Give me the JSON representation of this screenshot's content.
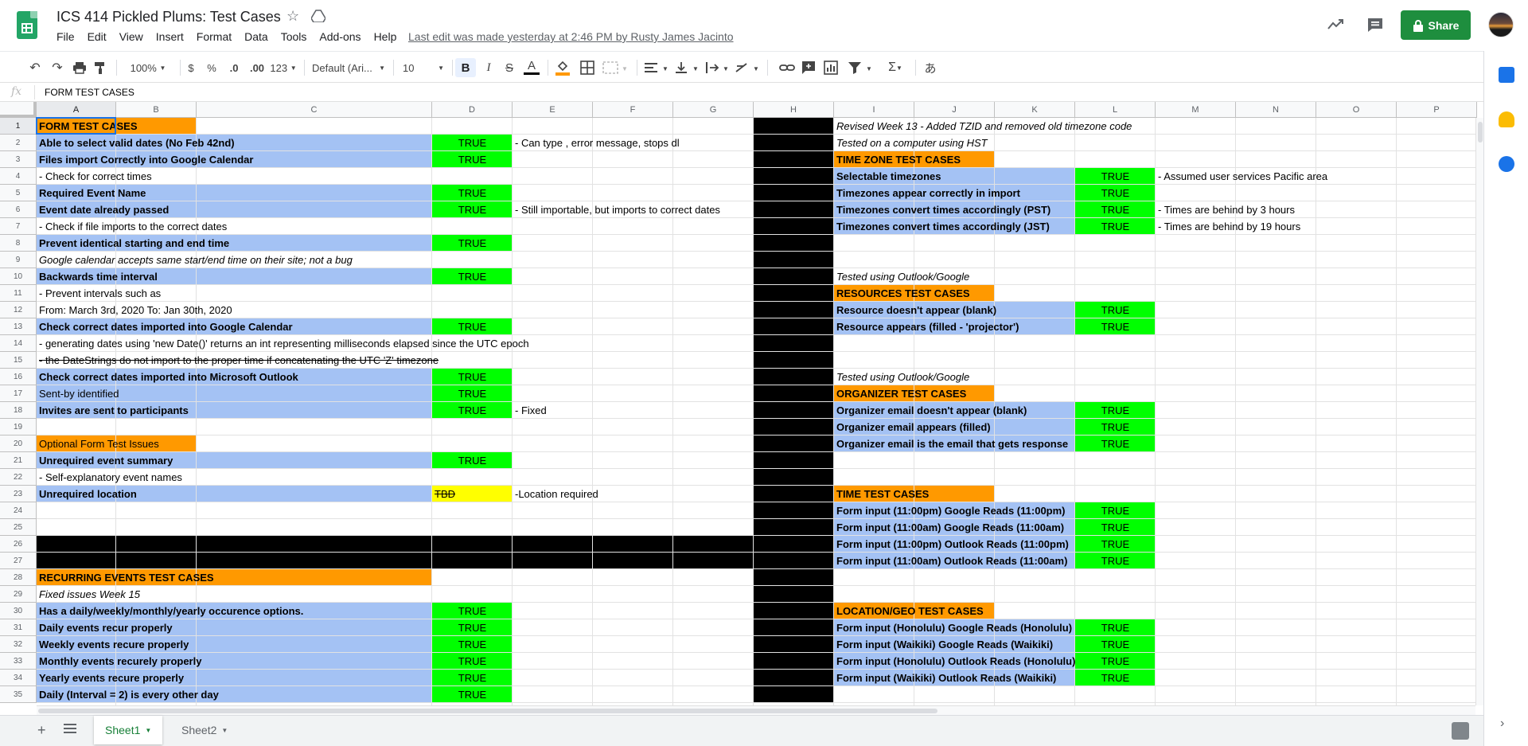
{
  "app": {
    "title": "ICS 414 Pickled Plums: Test Cases",
    "last_edit": "Last edit was made yesterday at 2:46 PM by Rusty James Jacinto",
    "share_label": "Share"
  },
  "menu": [
    "File",
    "Edit",
    "View",
    "Insert",
    "Format",
    "Data",
    "Tools",
    "Add-ons",
    "Help"
  ],
  "toolbar": {
    "zoom": "100%",
    "currency": "$",
    "percent": "%",
    "dec_less": ".0",
    "dec_more": ".00",
    "more_formats": "123",
    "font": "Default (Ari...",
    "font_size": "10",
    "input_tool": "あ"
  },
  "formula_bar": {
    "fx": "fx",
    "value": "FORM TEST CASES"
  },
  "columns": [
    "A",
    "B",
    "C",
    "D",
    "E",
    "F",
    "G",
    "H",
    "I",
    "J",
    "K",
    "L",
    "M",
    "N",
    "O",
    "P"
  ],
  "selected_column": "A",
  "rows": [
    "1",
    "2",
    "3",
    "4",
    "5",
    "6",
    "7",
    "8",
    "9",
    "10",
    "11",
    "12",
    "13",
    "14",
    "15",
    "16",
    "17",
    "18",
    "19",
    "20",
    "21",
    "22",
    "23",
    "24",
    "25",
    "26",
    "27",
    "28",
    "29",
    "30",
    "31",
    "32",
    "33",
    "34",
    "35"
  ],
  "selected_row": "1",
  "cells": [
    {
      "col": "A",
      "row": 1,
      "text": "FORM TEST CASES",
      "style": "b"
    },
    {
      "col": "A",
      "row": 2,
      "text": "Able to select valid dates (No Feb 42nd)",
      "style": "b"
    },
    {
      "col": "D",
      "row": 2,
      "text": "TRUE",
      "style": "c"
    },
    {
      "col": "E",
      "row": 2,
      "text": "- Can type , error message, stops dl",
      "style": ""
    },
    {
      "col": "A",
      "row": 3,
      "text": "Files import Correctly into Google Calendar",
      "style": "b"
    },
    {
      "col": "D",
      "row": 3,
      "text": "TRUE",
      "style": "c"
    },
    {
      "col": "A",
      "row": 4,
      "text": "- Check for correct times",
      "style": ""
    },
    {
      "col": "A",
      "row": 5,
      "text": "Required Event Name",
      "style": "b"
    },
    {
      "col": "D",
      "row": 5,
      "text": "TRUE",
      "style": "c"
    },
    {
      "col": "A",
      "row": 6,
      "text": "Event date already passed",
      "style": "b"
    },
    {
      "col": "D",
      "row": 6,
      "text": "TRUE",
      "style": "c"
    },
    {
      "col": "E",
      "row": 6,
      "text": "- Still importable, but imports to correct dates",
      "style": ""
    },
    {
      "col": "A",
      "row": 7,
      "text": "- Check if file imports to the correct dates",
      "style": ""
    },
    {
      "col": "A",
      "row": 8,
      "text": "Prevent identical starting and end time",
      "style": "b"
    },
    {
      "col": "D",
      "row": 8,
      "text": "TRUE",
      "style": "c"
    },
    {
      "col": "A",
      "row": 9,
      "text": "Google calendar accepts same start/end time on their site; not a bug",
      "style": "i"
    },
    {
      "col": "A",
      "row": 10,
      "text": "Backwards time interval",
      "style": "b"
    },
    {
      "col": "D",
      "row": 10,
      "text": "TRUE",
      "style": "c"
    },
    {
      "col": "A",
      "row": 11,
      "text": "- Prevent intervals such as",
      "style": ""
    },
    {
      "col": "A",
      "row": 12,
      "text": "  From: March 3rd, 2020 To: Jan 30th, 2020",
      "style": ""
    },
    {
      "col": "A",
      "row": 13,
      "text": "Check correct dates imported into Google Calendar",
      "style": "b"
    },
    {
      "col": "D",
      "row": 13,
      "text": "TRUE",
      "style": "c"
    },
    {
      "col": "A",
      "row": 14,
      "text": "- generating dates using 'new Date()' returns an int representing milliseconds elapsed since the UTC epoch",
      "style": ""
    },
    {
      "col": "A",
      "row": 15,
      "text": "- the DateStrings do not import to the proper time if concatenating the UTC 'Z' timezone",
      "style": "s"
    },
    {
      "col": "A",
      "row": 16,
      "text": "Check correct dates imported into Microsoft Outlook",
      "style": "b"
    },
    {
      "col": "D",
      "row": 16,
      "text": "TRUE",
      "style": "c"
    },
    {
      "col": "A",
      "row": 17,
      "text": "Sent-by identified",
      "style": ""
    },
    {
      "col": "D",
      "row": 17,
      "text": "TRUE",
      "style": "c"
    },
    {
      "col": "A",
      "row": 18,
      "text": "Invites are sent to participants",
      "style": "b"
    },
    {
      "col": "D",
      "row": 18,
      "text": "TRUE",
      "style": "c"
    },
    {
      "col": "E",
      "row": 18,
      "text": "- Fixed",
      "style": ""
    },
    {
      "col": "A",
      "row": 20,
      "text": "Optional Form Test Issues",
      "style": ""
    },
    {
      "col": "A",
      "row": 21,
      "text": "Unrequired event summary",
      "style": "b"
    },
    {
      "col": "D",
      "row": 21,
      "text": "TRUE",
      "style": "c"
    },
    {
      "col": "A",
      "row": 22,
      "text": "- Self-explanatory event names",
      "style": ""
    },
    {
      "col": "A",
      "row": 23,
      "text": "Unrequired location",
      "style": "b"
    },
    {
      "col": "D",
      "row": 23,
      "text": "TBD",
      "style": "s"
    },
    {
      "col": "E",
      "row": 23,
      "text": "-Location required",
      "style": ""
    },
    {
      "col": "A",
      "row": 28,
      "text": "RECURRING EVENTS TEST CASES",
      "style": "b"
    },
    {
      "col": "A",
      "row": 29,
      "text": "Fixed issues Week 15",
      "style": "i"
    },
    {
      "col": "A",
      "row": 30,
      "text": "Has a daily/weekly/monthly/yearly occurence options.",
      "style": "b"
    },
    {
      "col": "D",
      "row": 30,
      "text": "TRUE",
      "style": "c"
    },
    {
      "col": "A",
      "row": 31,
      "text": "Daily events recur properly",
      "style": "b"
    },
    {
      "col": "D",
      "row": 31,
      "text": "TRUE",
      "style": "c"
    },
    {
      "col": "A",
      "row": 32,
      "text": "Weekly events recure properly",
      "style": "b"
    },
    {
      "col": "D",
      "row": 32,
      "text": "TRUE",
      "style": "c"
    },
    {
      "col": "A",
      "row": 33,
      "text": "Monthly events recurely properly",
      "style": "b"
    },
    {
      "col": "D",
      "row": 33,
      "text": "TRUE",
      "style": "c"
    },
    {
      "col": "A",
      "row": 34,
      "text": "Yearly events recure properly",
      "style": "b"
    },
    {
      "col": "D",
      "row": 34,
      "text": "TRUE",
      "style": "c"
    },
    {
      "col": "A",
      "row": 35,
      "text": "Daily (Interval = 2) is every other day",
      "style": "b"
    },
    {
      "col": "D",
      "row": 35,
      "text": "TRUE",
      "style": "c"
    },
    {
      "col": "I",
      "row": 1,
      "text": "Revised Week 13 - Added TZID and removed old timezone code",
      "style": "i"
    },
    {
      "col": "I",
      "row": 2,
      "text": "Tested on a computer using HST",
      "style": "i"
    },
    {
      "col": "I",
      "row": 3,
      "text": "TIME ZONE TEST CASES",
      "style": "b"
    },
    {
      "col": "I",
      "row": 4,
      "text": "Selectable timezones",
      "style": "b"
    },
    {
      "col": "L",
      "row": 4,
      "text": "TRUE",
      "style": "c"
    },
    {
      "col": "M",
      "row": 4,
      "text": "- Assumed user services Pacific area",
      "style": ""
    },
    {
      "col": "I",
      "row": 5,
      "text": "Timezones appear correctly in import",
      "style": "b"
    },
    {
      "col": "L",
      "row": 5,
      "text": "TRUE",
      "style": "c"
    },
    {
      "col": "I",
      "row": 6,
      "text": "Timezones convert times accordingly (PST)",
      "style": "b"
    },
    {
      "col": "L",
      "row": 6,
      "text": "TRUE",
      "style": "c"
    },
    {
      "col": "M",
      "row": 6,
      "text": "- Times are behind by 3 hours",
      "style": ""
    },
    {
      "col": "I",
      "row": 7,
      "text": "Timezones convert times accordingly (JST)",
      "style": "b"
    },
    {
      "col": "L",
      "row": 7,
      "text": "TRUE",
      "style": "c"
    },
    {
      "col": "M",
      "row": 7,
      "text": "- Times are behind by 19 hours",
      "style": ""
    },
    {
      "col": "I",
      "row": 10,
      "text": "Tested using Outlook/Google",
      "style": "i"
    },
    {
      "col": "I",
      "row": 11,
      "text": "RESOURCES TEST CASES",
      "style": "b"
    },
    {
      "col": "I",
      "row": 12,
      "text": "Resource doesn't appear (blank)",
      "style": "b"
    },
    {
      "col": "L",
      "row": 12,
      "text": "TRUE",
      "style": "c"
    },
    {
      "col": "I",
      "row": 13,
      "text": "Resource appears (filled - 'projector')",
      "style": "b"
    },
    {
      "col": "L",
      "row": 13,
      "text": "TRUE",
      "style": "c"
    },
    {
      "col": "I",
      "row": 16,
      "text": "Tested using Outlook/Google",
      "style": "i"
    },
    {
      "col": "I",
      "row": 17,
      "text": "ORGANIZER TEST CASES",
      "style": "b"
    },
    {
      "col": "I",
      "row": 18,
      "text": "Organizer email doesn't appear (blank)",
      "style": "b"
    },
    {
      "col": "L",
      "row": 18,
      "text": "TRUE",
      "style": "c"
    },
    {
      "col": "I",
      "row": 19,
      "text": "Organizer email appears (filled)",
      "style": "b"
    },
    {
      "col": "L",
      "row": 19,
      "text": "TRUE",
      "style": "c"
    },
    {
      "col": "I",
      "row": 20,
      "text": "Organizer email is the email that gets response",
      "style": "b"
    },
    {
      "col": "L",
      "row": 20,
      "text": "TRUE",
      "style": "c"
    },
    {
      "col": "I",
      "row": 23,
      "text": "TIME TEST CASES",
      "style": "b"
    },
    {
      "col": "I",
      "row": 24,
      "text": "Form input (11:00pm) Google Reads (11:00pm)",
      "style": "b"
    },
    {
      "col": "L",
      "row": 24,
      "text": "TRUE",
      "style": "c"
    },
    {
      "col": "I",
      "row": 25,
      "text": "Form input (11:00am) Google Reads (11:00am)",
      "style": "b"
    },
    {
      "col": "L",
      "row": 25,
      "text": "TRUE",
      "style": "c"
    },
    {
      "col": "I",
      "row": 26,
      "text": "Form input (11:00pm) Outlook Reads (11:00pm)",
      "style": "b"
    },
    {
      "col": "L",
      "row": 26,
      "text": "TRUE",
      "style": "c"
    },
    {
      "col": "I",
      "row": 27,
      "text": "Form input (11:00am) Outlook Reads (11:00am)",
      "style": "b"
    },
    {
      "col": "L",
      "row": 27,
      "text": "TRUE",
      "style": "c"
    },
    {
      "col": "I",
      "row": 30,
      "text": "LOCATION/GEO TEST CASES",
      "style": "b"
    },
    {
      "col": "I",
      "row": 31,
      "text": "Form input (Honolulu) Google Reads (Honolulu)",
      "style": "b"
    },
    {
      "col": "L",
      "row": 31,
      "text": "TRUE",
      "style": "c"
    },
    {
      "col": "I",
      "row": 32,
      "text": "Form input (Waikiki) Google Reads (Waikiki)",
      "style": "b"
    },
    {
      "col": "L",
      "row": 32,
      "text": "TRUE",
      "style": "c"
    },
    {
      "col": "I",
      "row": 33,
      "text": "Form input (Honolulu) Outlook Reads (Honolulu)",
      "style": "b"
    },
    {
      "col": "L",
      "row": 33,
      "text": "TRUE",
      "style": "c"
    },
    {
      "col": "I",
      "row": 34,
      "text": "Form input (Waikiki) Outlook Reads (Waikiki)",
      "style": "b"
    },
    {
      "col": "L",
      "row": 34,
      "text": "TRUE",
      "style": "c"
    }
  ],
  "fills": [
    {
      "from": "A",
      "to": "B",
      "rows": [
        1,
        1
      ],
      "color": "#ff9900"
    },
    {
      "from": "A",
      "to": "C",
      "rows": [
        2,
        3
      ],
      "color": "#a4c2f4"
    },
    {
      "from": "A",
      "to": "C",
      "rows": [
        5,
        6
      ],
      "color": "#a4c2f4"
    },
    {
      "from": "A",
      "to": "C",
      "rows": [
        8,
        8
      ],
      "color": "#a4c2f4"
    },
    {
      "from": "A",
      "to": "C",
      "rows": [
        10,
        10
      ],
      "color": "#a4c2f4"
    },
    {
      "from": "A",
      "to": "C",
      "rows": [
        13,
        13
      ],
      "color": "#a4c2f4"
    },
    {
      "from": "A",
      "to": "C",
      "rows": [
        16,
        18
      ],
      "color": "#a4c2f4"
    },
    {
      "from": "A",
      "to": "B",
      "rows": [
        20,
        20
      ],
      "color": "#ff9900"
    },
    {
      "from": "A",
      "to": "C",
      "rows": [
        21,
        21
      ],
      "color": "#a4c2f4"
    },
    {
      "from": "A",
      "to": "C",
      "rows": [
        23,
        23
      ],
      "color": "#a4c2f4"
    },
    {
      "from": "A",
      "to": "G",
      "rows": [
        26,
        27
      ],
      "color": "#000000"
    },
    {
      "from": "A",
      "to": "C",
      "rows": [
        28,
        28
      ],
      "color": "#ff9900"
    },
    {
      "from": "A",
      "to": "C",
      "rows": [
        30,
        35
      ],
      "color": "#a4c2f4"
    },
    {
      "from": "D",
      "to": "D",
      "rows": [
        2,
        3
      ],
      "color": "#00ff00"
    },
    {
      "from": "D",
      "to": "D",
      "rows": [
        5,
        6
      ],
      "color": "#00ff00"
    },
    {
      "from": "D",
      "to": "D",
      "rows": [
        8,
        8
      ],
      "color": "#00ff00"
    },
    {
      "from": "D",
      "to": "D",
      "rows": [
        10,
        10
      ],
      "color": "#00ff00"
    },
    {
      "from": "D",
      "to": "D",
      "rows": [
        13,
        13
      ],
      "color": "#00ff00"
    },
    {
      "from": "D",
      "to": "D",
      "rows": [
        16,
        18
      ],
      "color": "#00ff00"
    },
    {
      "from": "D",
      "to": "D",
      "rows": [
        21,
        21
      ],
      "color": "#00ff00"
    },
    {
      "from": "D",
      "to": "D",
      "rows": [
        23,
        23
      ],
      "color": "#ffff00"
    },
    {
      "from": "D",
      "to": "D",
      "rows": [
        30,
        35
      ],
      "color": "#00ff00"
    },
    {
      "from": "H",
      "to": "H",
      "rows": [
        1,
        35
      ],
      "color": "#000000"
    },
    {
      "from": "I",
      "to": "J",
      "rows": [
        3,
        3
      ],
      "color": "#ff9900"
    },
    {
      "from": "I",
      "to": "K",
      "rows": [
        4,
        7
      ],
      "color": "#a4c2f4"
    },
    {
      "from": "L",
      "to": "L",
      "rows": [
        4,
        7
      ],
      "color": "#00ff00"
    },
    {
      "from": "I",
      "to": "J",
      "rows": [
        11,
        11
      ],
      "color": "#ff9900"
    },
    {
      "from": "I",
      "to": "K",
      "rows": [
        12,
        13
      ],
      "color": "#a4c2f4"
    },
    {
      "from": "L",
      "to": "L",
      "rows": [
        12,
        13
      ],
      "color": "#00ff00"
    },
    {
      "from": "I",
      "to": "J",
      "rows": [
        17,
        17
      ],
      "color": "#ff9900"
    },
    {
      "from": "I",
      "to": "K",
      "rows": [
        18,
        20
      ],
      "color": "#a4c2f4"
    },
    {
      "from": "L",
      "to": "L",
      "rows": [
        18,
        20
      ],
      "color": "#00ff00"
    },
    {
      "from": "I",
      "to": "J",
      "rows": [
        23,
        23
      ],
      "color": "#ff9900"
    },
    {
      "from": "I",
      "to": "K",
      "rows": [
        24,
        27
      ],
      "color": "#a4c2f4"
    },
    {
      "from": "L",
      "to": "L",
      "rows": [
        24,
        27
      ],
      "color": "#00ff00"
    },
    {
      "from": "I",
      "to": "J",
      "rows": [
        30,
        30
      ],
      "color": "#ff9900"
    },
    {
      "from": "I",
      "to": "K",
      "rows": [
        31,
        34
      ],
      "color": "#a4c2f4"
    },
    {
      "from": "L",
      "to": "L",
      "rows": [
        31,
        34
      ],
      "color": "#00ff00"
    }
  ],
  "sheets": [
    {
      "name": "Sheet1",
      "active": true
    },
    {
      "name": "Sheet2",
      "active": false
    }
  ],
  "side_panel": [
    {
      "name": "calendar-icon",
      "color": "#1a73e8"
    },
    {
      "name": "keep-icon",
      "color": "#fbbc04"
    },
    {
      "name": "tasks-icon",
      "color": "#1a73e8"
    }
  ],
  "colors": {
    "share": "#1e8e3e",
    "selection": "#1a73e8",
    "blue_fill": "#a4c2f4",
    "green_fill": "#00ff00",
    "orange_fill": "#ff9900",
    "yellow_fill": "#ffff00"
  }
}
